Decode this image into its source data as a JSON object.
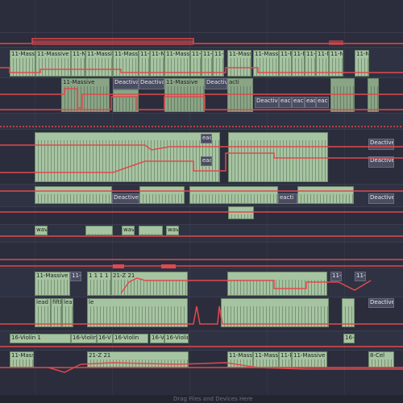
{
  "arrangement": {
    "clip_names": {
      "massive": "11-Massive",
      "massive_short": "11-Massi",
      "n11": "11-N",
      "m11": "11-M",
      "deactivated": "Deactivated",
      "deactive_short": "Deactive",
      "eacti": "eacti",
      "acti": "acti",
      "wave": "wave",
      "lead": "lead",
      "fifth": "fifth",
      "le": "le",
      "n21": "21-Z",
      "violin1": "16-Violin 1",
      "violin": "16-Violin",
      "violin_v": "16-V",
      "cel": "8-Cel",
      "ones": "1 1 1 1",
      "z21": "21-Z 21"
    },
    "status_text": "Drag Files and Devices Here"
  },
  "colors": {
    "clip": "#a6c4a1",
    "deactivated": "#4a4d60",
    "automation": "#e0494d",
    "background": "#2b2d3c"
  }
}
